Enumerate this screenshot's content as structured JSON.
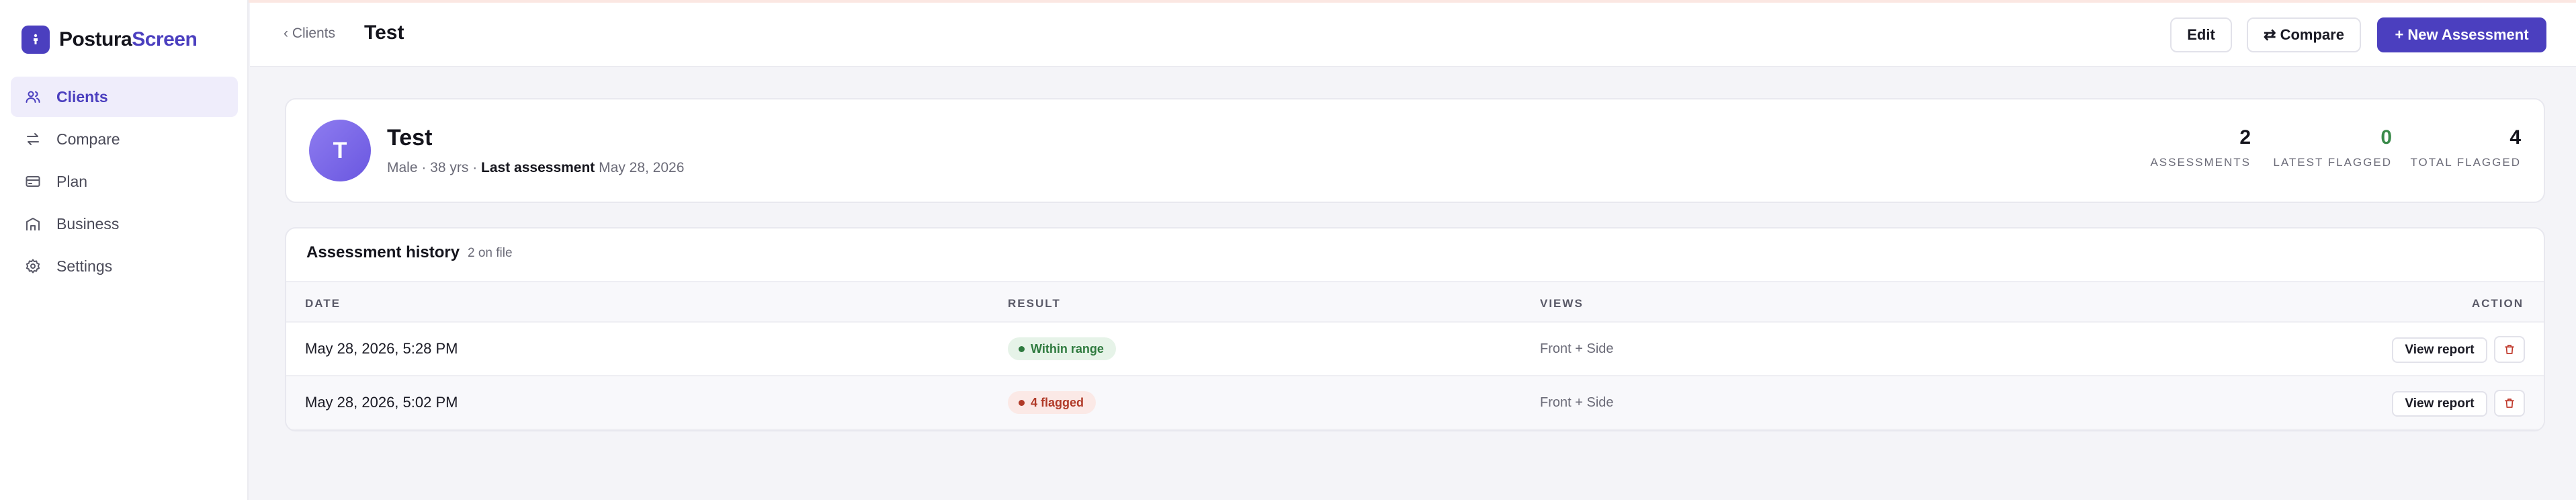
{
  "brand": {
    "name_part1": "Postura",
    "name_part2": "Screen",
    "accent_color": "#4b3fbf"
  },
  "sidebar": {
    "items": [
      {
        "label": "Clients",
        "icon": "users-icon",
        "active": true
      },
      {
        "label": "Compare",
        "icon": "arrows-swap-icon",
        "active": false
      },
      {
        "label": "Plan",
        "icon": "credit-card-icon",
        "active": false
      },
      {
        "label": "Business",
        "icon": "building-icon",
        "active": false
      },
      {
        "label": "Settings",
        "icon": "gear-icon",
        "active": false
      }
    ]
  },
  "header": {
    "back_label": "‹ Clients",
    "title": "Test",
    "edit_label": "Edit",
    "compare_label": "⇄ Compare",
    "new_label": "+ New Assessment"
  },
  "client": {
    "initial": "T",
    "name": "Test",
    "meta_prefix": "Male · 38 yrs · ",
    "meta_last_label": "Last assessment",
    "meta_last_date": "May 28, 2026",
    "stats": [
      {
        "value": "2",
        "label": "ASSESSMENTS"
      },
      {
        "value": "0",
        "label": "LATEST FLAGGED"
      },
      {
        "value": "4",
        "label": "TOTAL FLAGGED"
      }
    ]
  },
  "history": {
    "title": "Assessment history",
    "count": "2 on file",
    "columns": {
      "date": "DATE",
      "result": "RESULT",
      "views": "VIEWS",
      "action": "ACTION"
    },
    "rows": [
      {
        "date": "May 28, 2026, 5:28 PM",
        "result": "Within range",
        "status": "ok",
        "views": "Front + Side",
        "action": "View report"
      },
      {
        "date": "May 28, 2026, 5:02 PM",
        "result": "4 flagged",
        "status": "flag",
        "views": "Front + Side",
        "action": "View report"
      }
    ]
  }
}
